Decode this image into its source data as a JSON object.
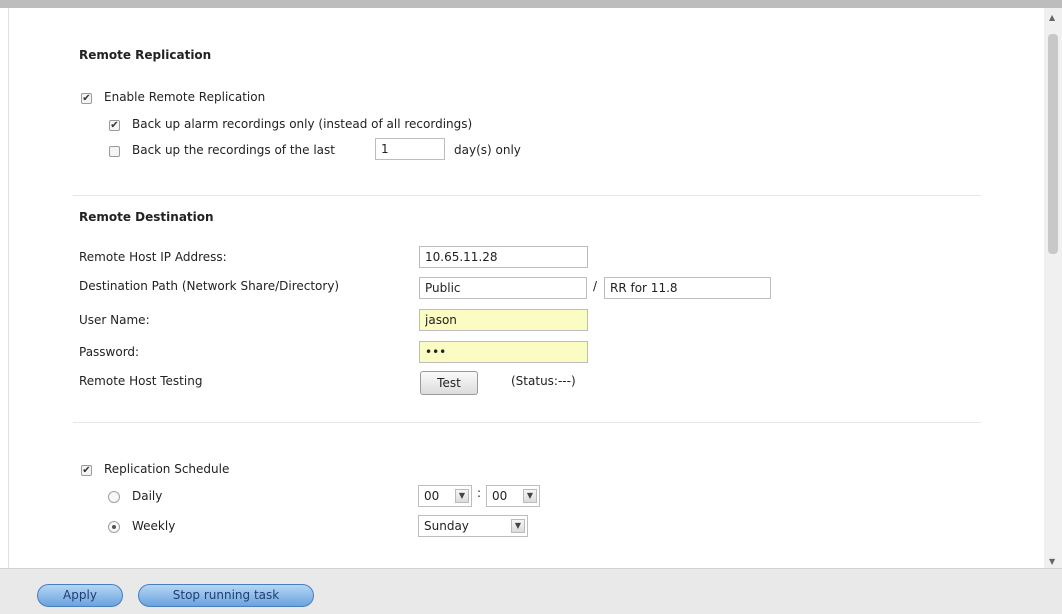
{
  "remote_replication": {
    "title": "Remote Replication",
    "enable_label": "Enable Remote Replication",
    "enable_checked": true,
    "alarm_only_label": "Back up alarm recordings only (instead of all recordings)",
    "alarm_only_checked": true,
    "last_days_label": "Back up the recordings of the last",
    "last_days_checked": false,
    "last_days_value": "1",
    "days_suffix": "day(s) only"
  },
  "remote_destination": {
    "title": "Remote Destination",
    "host_ip_label": "Remote Host IP Address:",
    "host_ip_value": "10.65.11.28",
    "dest_path_label": "Destination Path (Network Share/Directory)",
    "dest_share_value": "Public",
    "path_separator": "/",
    "dest_dir_value": "RR for 11.8",
    "username_label": "User Name:",
    "username_value": "jason",
    "password_label": "Password:",
    "password_value": "•••",
    "testing_label": "Remote Host Testing",
    "test_button": "Test",
    "status_text": "(Status:---)"
  },
  "schedule": {
    "label": "Replication Schedule",
    "checked": true,
    "daily_label": "Daily",
    "daily_selected": false,
    "hour_value": "00",
    "time_separator": ":",
    "minute_value": "00",
    "weekly_label": "Weekly",
    "weekly_selected": true,
    "weekday_value": "Sunday"
  },
  "footer": {
    "apply_button": "Apply",
    "stop_button": "Stop running task"
  },
  "icons": {
    "dropdown": "chevron-down-icon",
    "scroll_up": "triangle-up-icon",
    "scroll_down": "triangle-down-icon"
  }
}
